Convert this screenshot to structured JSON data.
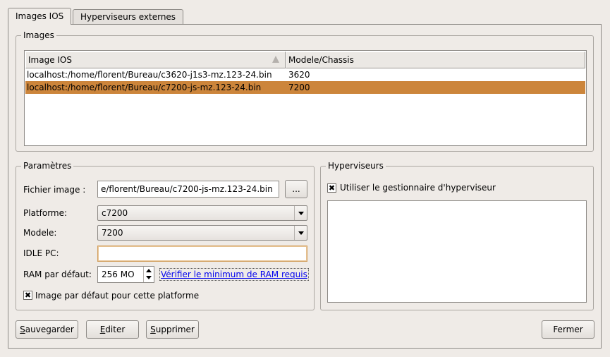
{
  "tabs": [
    {
      "label": "Images IOS"
    },
    {
      "label": "Hyperviseurs externes"
    }
  ],
  "images_group": {
    "title": "Images",
    "columns": [
      "Image IOS",
      "Modele/Chassis"
    ],
    "rows": [
      {
        "image": "localhost:/home/florent/Bureau/c3620-j1s3-mz.123-24.bin",
        "model": "3620",
        "selected": false
      },
      {
        "image": "localhost:/home/florent/Bureau/c7200-js-mz.123-24.bin",
        "model": "7200",
        "selected": true
      }
    ]
  },
  "params": {
    "title": "Paramètres",
    "file_label": "Fichier image :",
    "file_value": "e/florent/Bureau/c7200-js-mz.123-24.bin",
    "browse_label": "...",
    "platform_label": "Platforme:",
    "platform_value": "c7200",
    "model_label": "Modele:",
    "model_value": "7200",
    "idle_label": "IDLE PC:",
    "idle_value": "",
    "ram_label": "RAM par défaut:",
    "ram_value": "256 MO",
    "ram_link": "Vérifier le minimum de RAM requis",
    "default_label": "Image par défaut pour cette platforme",
    "default_checked": true
  },
  "hypervisors": {
    "title": "Hyperviseurs",
    "use_manager_label": "Utiliser le gestionnaire d'hyperviseur",
    "use_manager_checked": true
  },
  "buttons": {
    "save": "Sauvegarder",
    "edit": "Editer",
    "delete": "Supprimer",
    "close": "Fermer"
  },
  "colors": {
    "selection": "#cc853b",
    "idle_focus": "#d2a060"
  }
}
